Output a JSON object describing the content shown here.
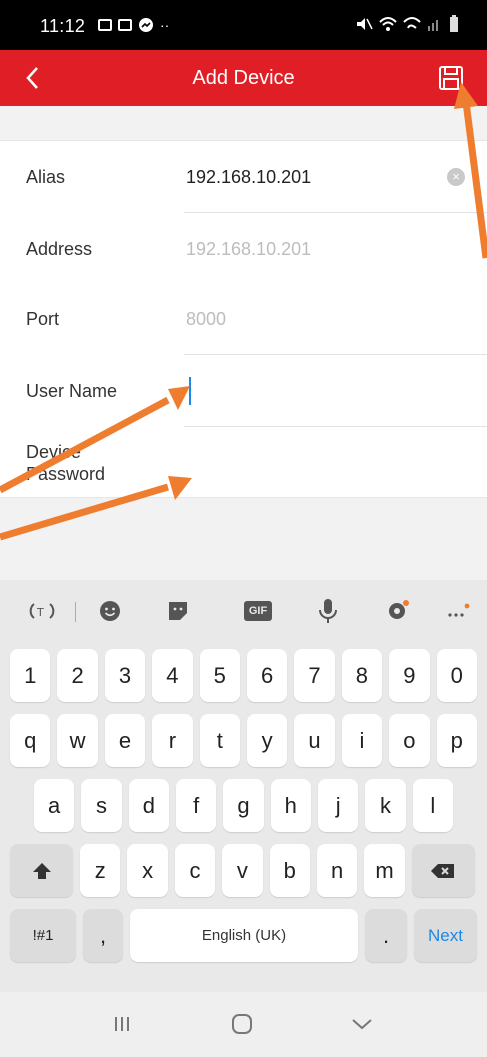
{
  "status_bar": {
    "time": "11:12"
  },
  "header": {
    "title": "Add Device"
  },
  "form": {
    "alias": {
      "label": "Alias",
      "value": "192.168.10.201"
    },
    "address": {
      "label": "Address",
      "placeholder": "192.168.10.201"
    },
    "port": {
      "label": "Port",
      "placeholder": "8000"
    },
    "user_name": {
      "label": "User Name",
      "value": ""
    },
    "device_password": {
      "label_line1": "Device",
      "label_line2": "Password",
      "value": ""
    }
  },
  "keyboard": {
    "toolbar": [
      "translate-icon",
      "emoji-icon",
      "sticker-icon",
      "gif-icon",
      "mic-icon",
      "settings-icon",
      "more-icon"
    ],
    "gif_label": "GIF",
    "row_numbers": [
      "1",
      "2",
      "3",
      "4",
      "5",
      "6",
      "7",
      "8",
      "9",
      "0"
    ],
    "row_1": [
      "q",
      "w",
      "e",
      "r",
      "t",
      "y",
      "u",
      "i",
      "o",
      "p"
    ],
    "row_2": [
      "a",
      "s",
      "d",
      "f",
      "g",
      "h",
      "j",
      "k",
      "l"
    ],
    "row_3": [
      "z",
      "x",
      "c",
      "v",
      "b",
      "n",
      "m"
    ],
    "symbols_label": "!#1",
    "comma_label": ",",
    "space_label": "English (UK)",
    "period_label": ".",
    "next_label": "Next"
  },
  "colors": {
    "header_bg": "#e01e25",
    "arrow": "#ee7d2f",
    "cursor": "#1e88e5",
    "next_text": "#1e88e5"
  }
}
